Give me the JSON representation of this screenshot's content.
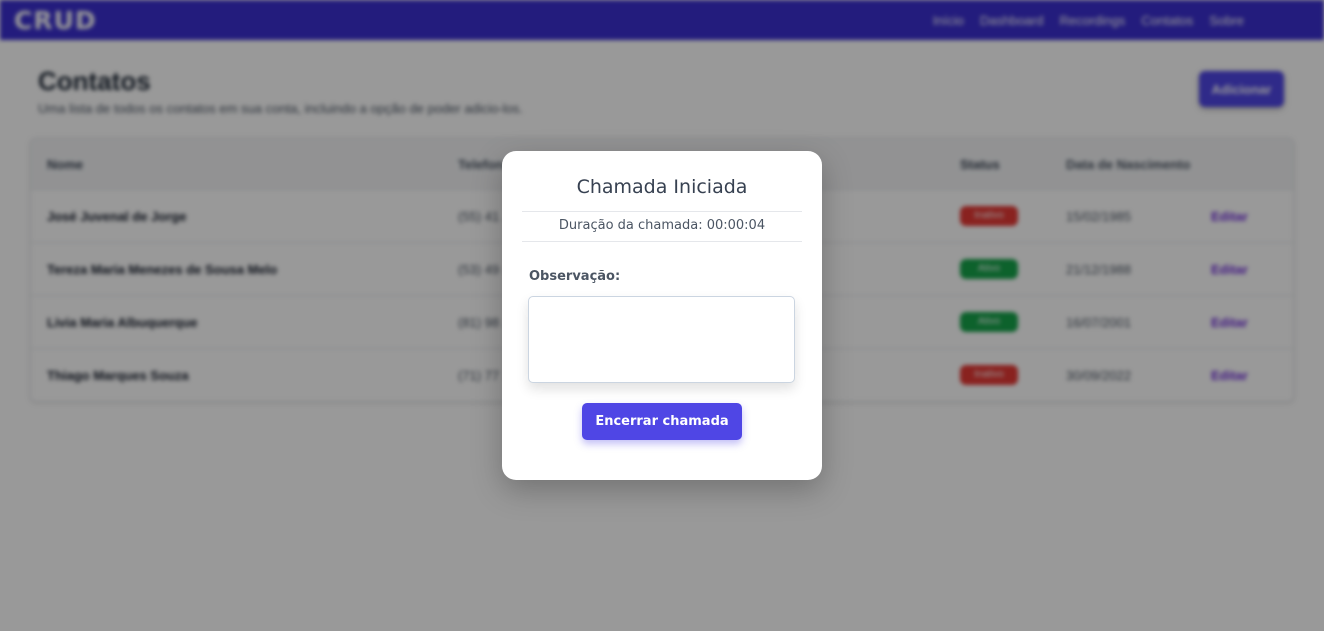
{
  "navbar": {
    "logo": "CRUD",
    "links": [
      "Início",
      "Dashboard",
      "Recordings",
      "Contatos",
      "Sobre"
    ]
  },
  "page": {
    "title": "Contatos",
    "subtitle": "Uma lista de todos os contatos em sua conta, incluindo a opção de poder adicio-los.",
    "add_button": "Adicionar"
  },
  "table": {
    "headers": {
      "nome": "Nome",
      "telefone": "Telefone",
      "status": "Status",
      "data": "Data de Nascimento"
    },
    "rows": [
      {
        "nome": "José Juvenal de Jorge",
        "telefone": "(55) 41 ...",
        "status": "Inativo",
        "status_color": "#e53935",
        "data": "15/02/1985",
        "acao": "Editar"
      },
      {
        "nome": "Tereza Maria Menezes de Sousa Melo",
        "telefone": "(53) 49 ...",
        "status": "Ativo",
        "status_color": "#16a34a",
        "data": "21/12/1988",
        "acao": "Editar"
      },
      {
        "nome": "Livia Maria Albuquerque",
        "telefone": "(81) 98 ...",
        "status": "Ativo",
        "status_color": "#16a34a",
        "data": "16/07/2001",
        "acao": "Editar"
      },
      {
        "nome": "Thiago Marques Souza",
        "telefone": "(71) 77 ...",
        "status": "Inativo",
        "status_color": "#e53935",
        "data": "30/09/2022",
        "acao": "Editar"
      }
    ]
  },
  "modal": {
    "title": "Chamada Iniciada",
    "duration_text": "Duração da chamada: 00:00:04",
    "observation_label": "Observação:",
    "observation_value": "",
    "end_call_button": "Encerrar chamada"
  },
  "colors": {
    "accent": "#4f46e5",
    "navbar": "#3b2fd0",
    "inactive": "#e53935",
    "active": "#16a34a"
  }
}
